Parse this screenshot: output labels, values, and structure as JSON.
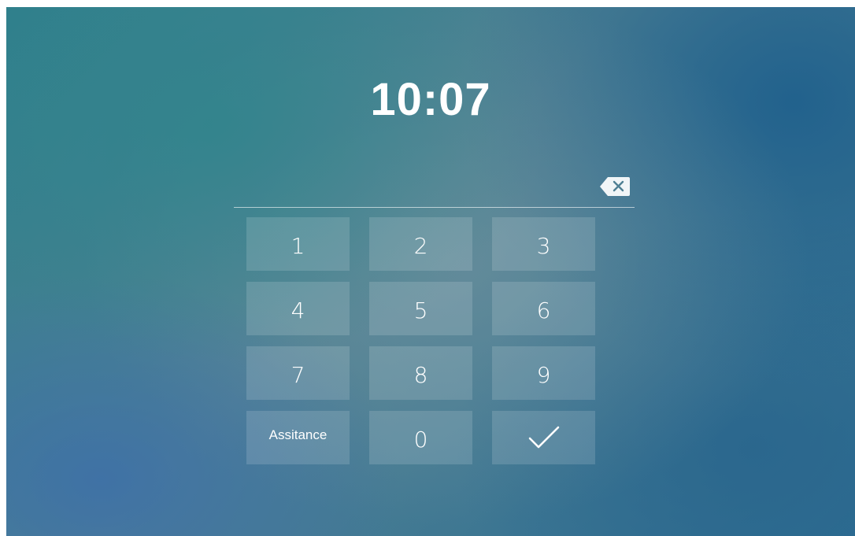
{
  "clock": {
    "time": "10:07"
  },
  "pin": {
    "value": "",
    "backspace_icon": "backspace-icon"
  },
  "keypad": {
    "keys": [
      {
        "label": "1"
      },
      {
        "label": "2"
      },
      {
        "label": "3"
      },
      {
        "label": "4"
      },
      {
        "label": "5"
      },
      {
        "label": "6"
      },
      {
        "label": "7"
      },
      {
        "label": "8"
      },
      {
        "label": "9"
      },
      {
        "label": "Assitance"
      },
      {
        "label": "0"
      },
      {
        "icon": "check-icon"
      }
    ]
  },
  "colors": {
    "text": "#ffffff",
    "key_bg": "rgba(255,255,255,0.14)"
  }
}
